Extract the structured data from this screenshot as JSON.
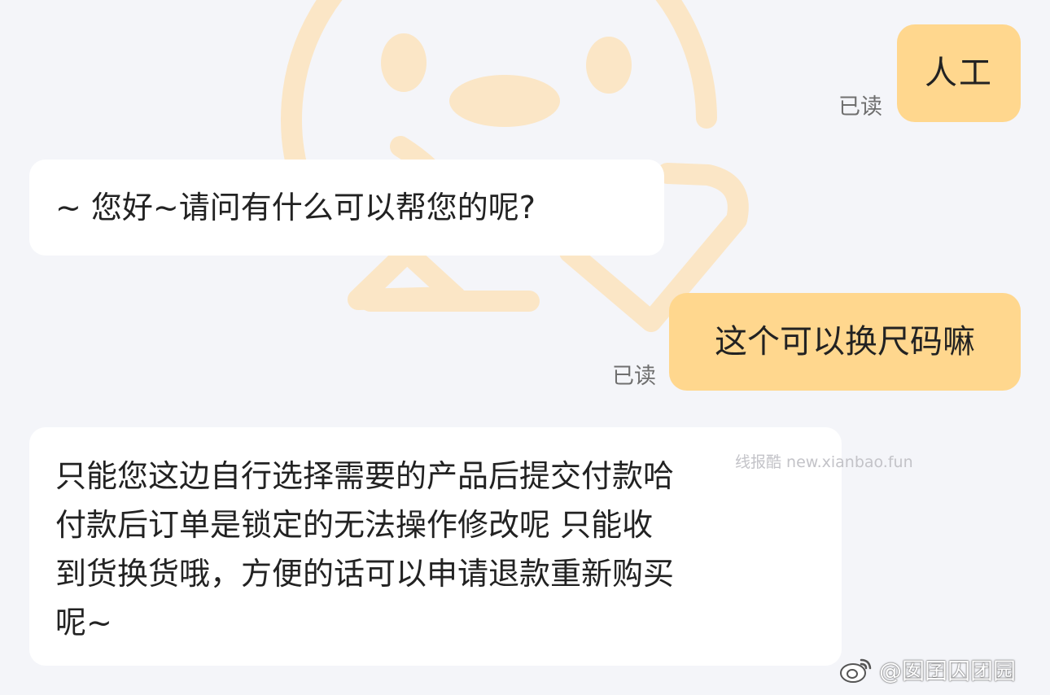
{
  "chat": {
    "messages": [
      {
        "side": "out",
        "text": "人工",
        "read_label": "已读"
      },
      {
        "side": "in",
        "text": "~ 您好~请问有什么可以帮您的呢?"
      },
      {
        "side": "out",
        "text": "这个可以换尺码嘛",
        "read_label": "已读"
      },
      {
        "side": "in",
        "lines": [
          "只能您这边自行选择需要的产品后提交付款哈",
          "付款后订单是锁定的无法操作修改呢  只能收",
          "到货换货哦，方便的话可以申请退款重新购买",
          "呢~"
        ]
      }
    ]
  },
  "watermarks": {
    "site": "线报酷 new.xianbao.fun",
    "weibo_handle": "@囡囝囚团园"
  },
  "colors": {
    "background": "#f4f5f9",
    "outgoing_bubble": "#ffd78e",
    "incoming_bubble": "#ffffff",
    "mascot": "#fbe6c6"
  },
  "icons": {
    "background_art": "smiley-mascot-icon",
    "weibo": "weibo-logo-icon"
  }
}
